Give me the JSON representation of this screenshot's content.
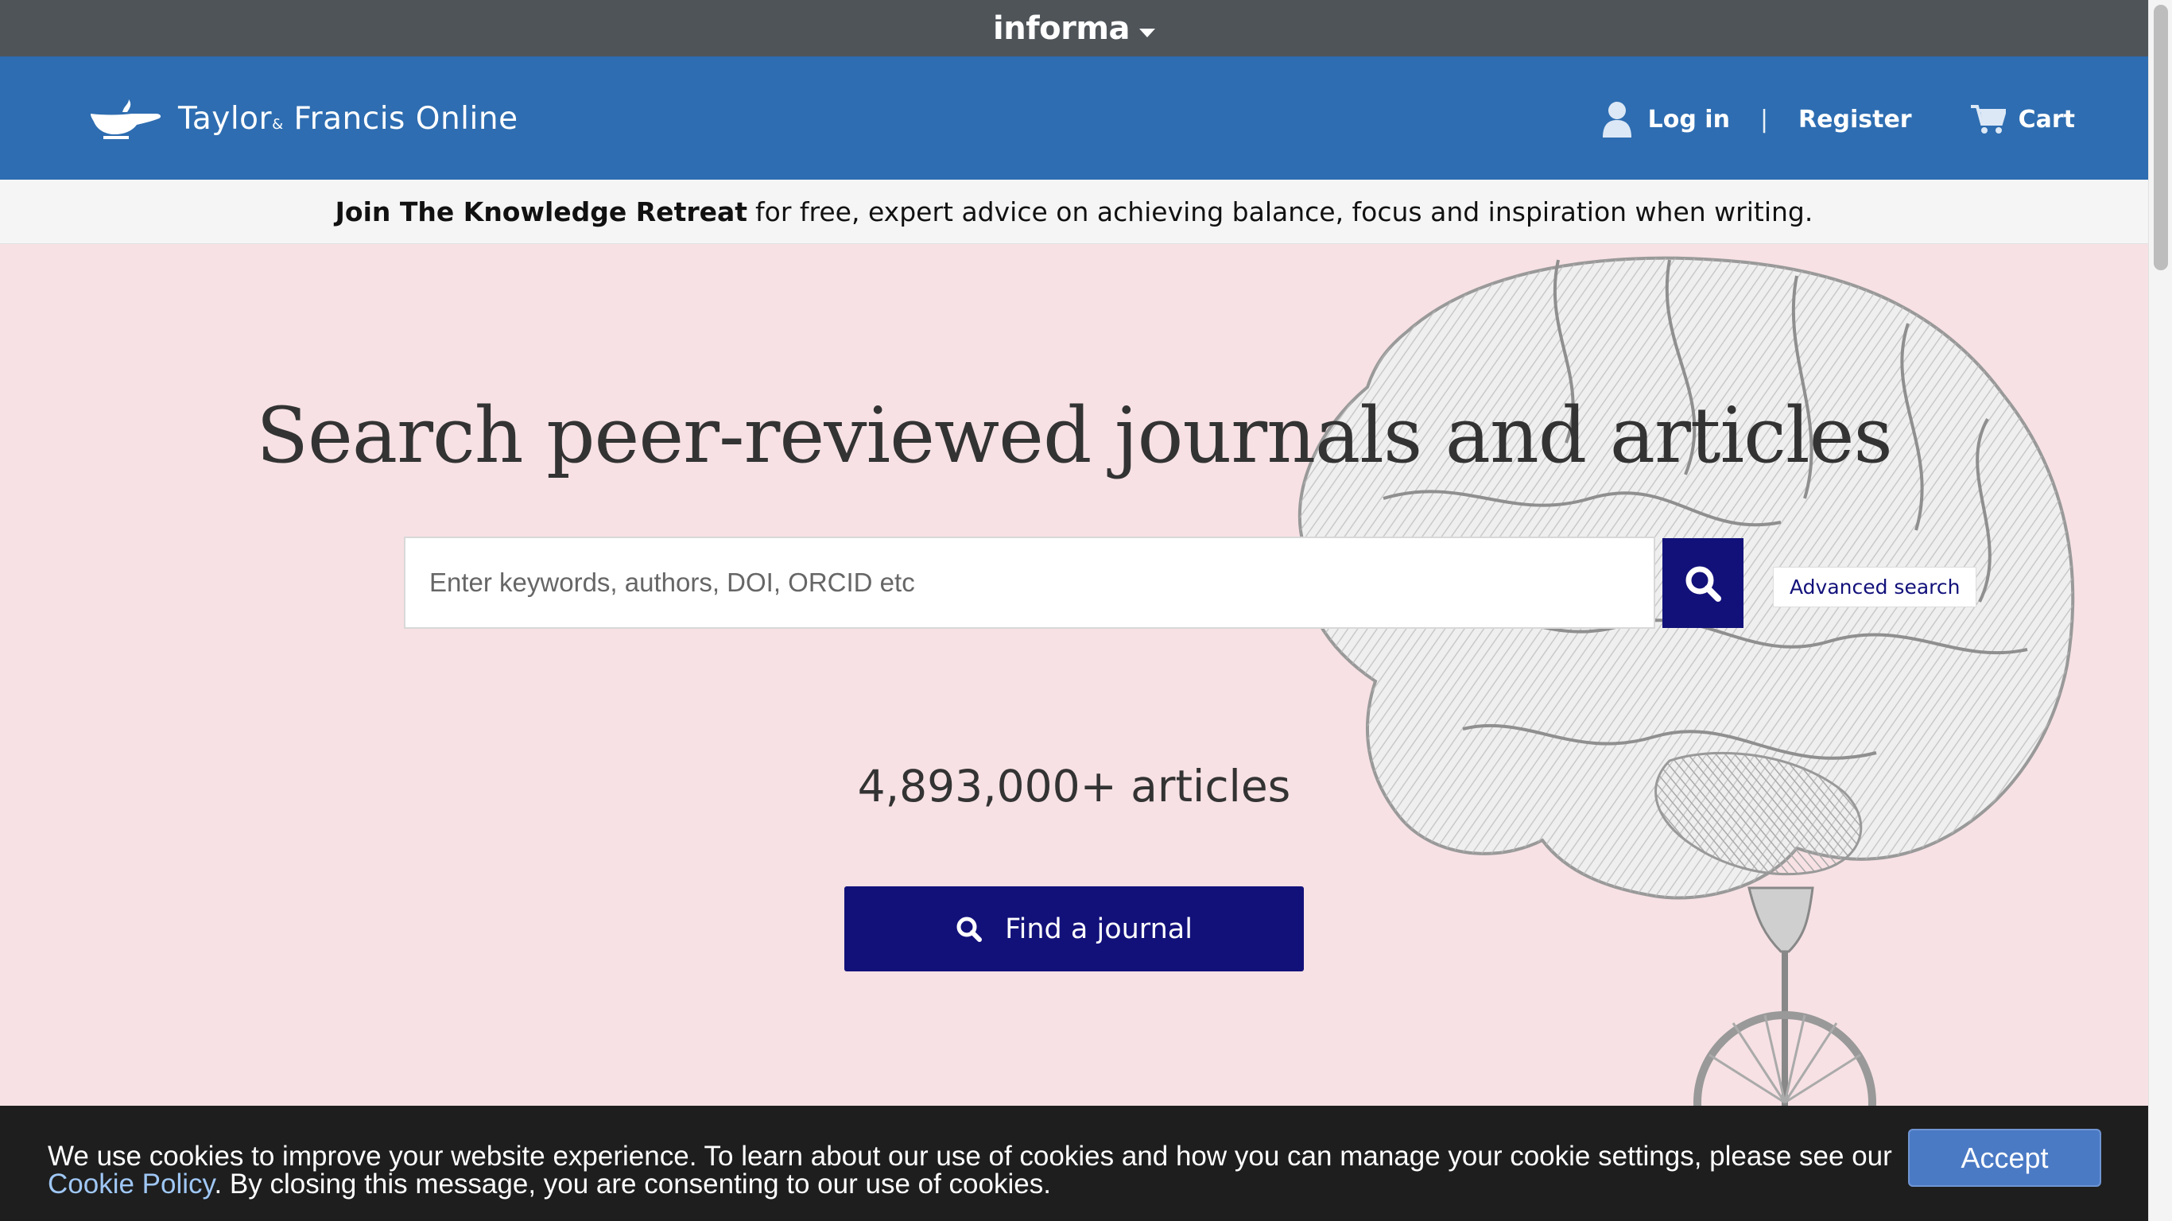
{
  "informa_bar": {
    "brand": "informa"
  },
  "header": {
    "logo_text": "Taylor",
    "logo_amp": "&",
    "logo_text2": "Francis Online",
    "login_label": "Log in",
    "separator": "|",
    "register_label": "Register",
    "cart_label": "Cart"
  },
  "announcement": {
    "bold": "Join The Knowledge Retreat",
    "text": "for free, expert advice on achieving balance, focus and inspiration when writing."
  },
  "hero": {
    "title": "Search peer-reviewed journals and articles",
    "search_placeholder": "Enter keywords, authors, DOI, ORCID etc",
    "advanced_search_label": "Advanced search",
    "article_count": "4,893,000+ articles",
    "find_journal_label": "Find a journal"
  },
  "cookie_banner": {
    "text_before": "We use cookies to improve your website experience. To learn about our use of cookies and how you can manage your cookie settings, please see our ",
    "link_text": "Cookie Policy",
    "text_after": ". By closing this message, you are consenting to our use of cookies.",
    "accept_label": "Accept"
  },
  "icons": {
    "informa_caret": "chevron-down-icon",
    "logo": "teapot-lamp-logo-icon",
    "user": "user-icon",
    "cart": "cart-icon",
    "search": "search-icon"
  },
  "colors": {
    "informa_bar": "#4f5459",
    "header_blue": "#2e6db1",
    "hero_bg": "#f7e1e4",
    "navy_button": "#12117a",
    "cookie_bg": "#1e1e1e",
    "accept_button": "#4b7ac5",
    "cookie_link": "#9fc7f5"
  }
}
